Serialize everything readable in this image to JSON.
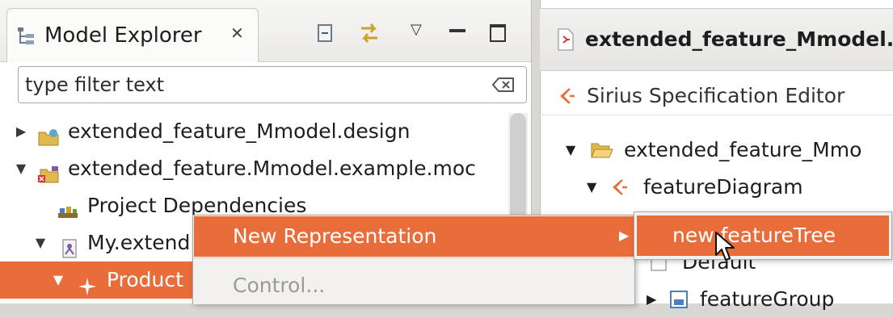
{
  "explorer": {
    "tab_title": "Model Explorer",
    "filter_placeholder": "type filter text",
    "tree": [
      {
        "label": "extended_feature_Mmodel.design",
        "expanded": false
      },
      {
        "label": "extended_feature.Mmodel.example.moc",
        "expanded": true
      },
      {
        "label": "Project Dependencies"
      },
      {
        "label": "My.extend",
        "expanded": true
      },
      {
        "label": "Product",
        "expanded": true,
        "selected": true
      }
    ]
  },
  "editor": {
    "tab_title": "extended_feature_Mmodel.",
    "header_title": "Sirius Specification Editor",
    "tree": [
      {
        "label": "extended_feature_Mmo",
        "expanded": true
      },
      {
        "label": "featureDiagram",
        "expanded": true
      },
      {
        "label": "Default"
      },
      {
        "label": "featureGroup",
        "expanded": false
      }
    ]
  },
  "context_menu": {
    "items": [
      {
        "label": "New Representation",
        "enabled": true,
        "highlighted": true,
        "has_submenu": true
      },
      {
        "label": "Control...",
        "enabled": false
      }
    ],
    "submenu": [
      {
        "label": "new featureTree",
        "highlighted": true
      }
    ]
  },
  "colors": {
    "selection": "#e96d3a",
    "menu_bg": "#f2f1f0",
    "disabled_text": "#9a9a9a"
  },
  "icons": {
    "explorer_tab": "model-explorer-icon",
    "collapse_all": "collapse-all-icon",
    "link_editor": "link-with-editor-icon",
    "view_menu": "view-menu-icon",
    "minimize": "minimize-icon",
    "maximize": "maximize-icon",
    "clear_filter": "clear-filter-icon",
    "cursor": "mouse-pointer-icon"
  }
}
